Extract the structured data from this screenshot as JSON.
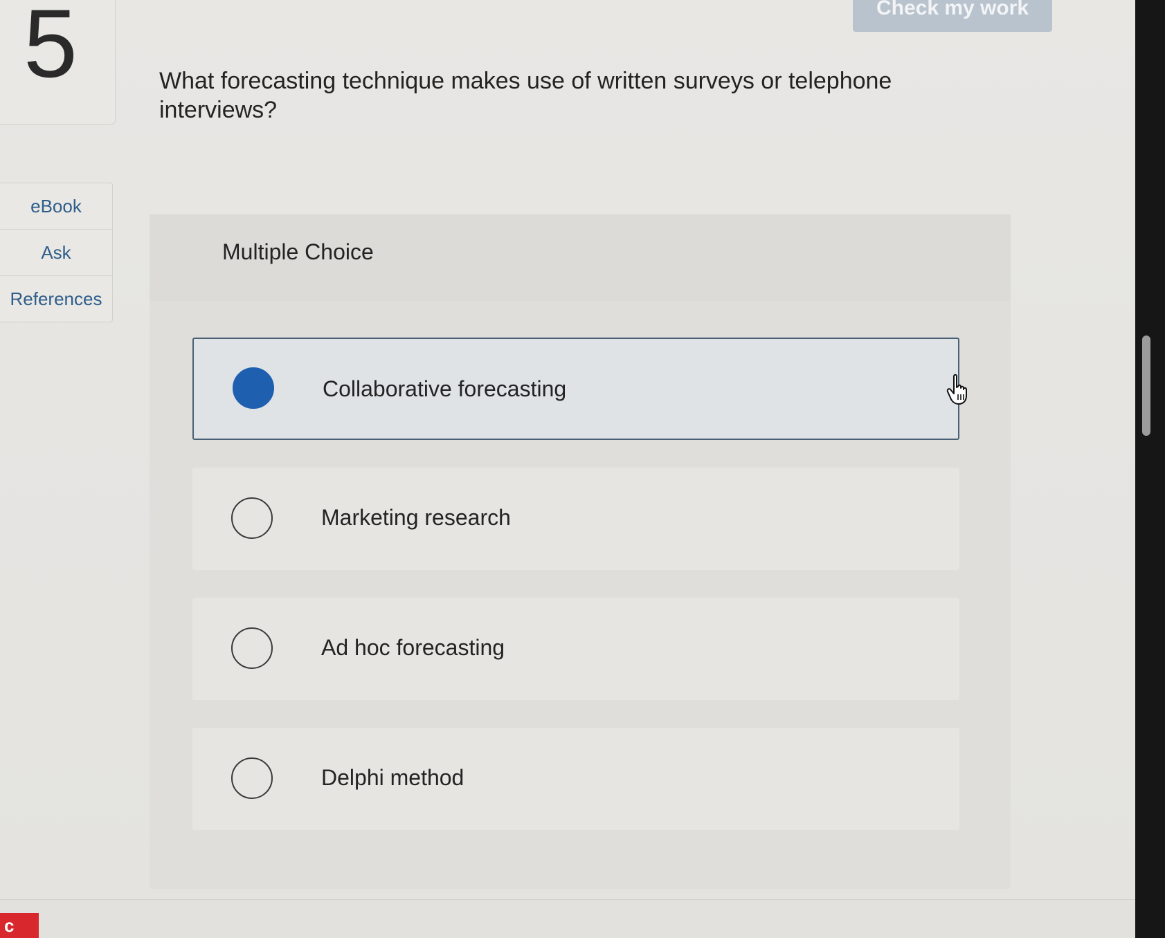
{
  "question": {
    "number": "5",
    "text": "What forecasting technique makes use of written surveys or telephone interviews?"
  },
  "header": {
    "check_my_work_label": "Check my work"
  },
  "side_tools": [
    {
      "label": "eBook"
    },
    {
      "label": "Ask"
    },
    {
      "label": "References"
    }
  ],
  "panel": {
    "title": "Multiple Choice",
    "options": [
      {
        "label": "Collaborative forecasting",
        "selected": true
      },
      {
        "label": "Marketing research",
        "selected": false
      },
      {
        "label": "Ad hoc forecasting",
        "selected": false
      },
      {
        "label": "Delphi method",
        "selected": false
      }
    ]
  },
  "footer": {
    "logo_letter": "c"
  },
  "colors": {
    "selected_radio": "#1f5fb0",
    "link_text": "#2f5d8a",
    "button_bg": "#b9c3cd"
  },
  "icons": {
    "cursor": "hand-pointer-icon",
    "scrollbar": "scrollbar-thumb"
  }
}
